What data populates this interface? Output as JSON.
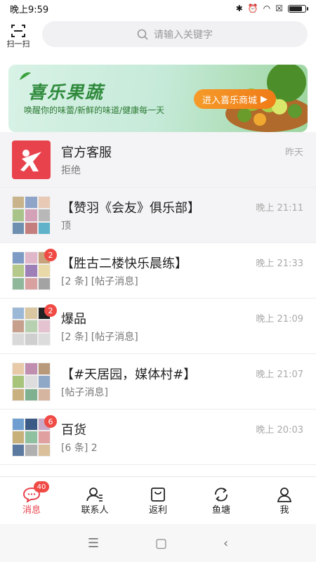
{
  "status": {
    "time": "晚上9:59"
  },
  "topbar": {
    "scan_label": "扫一扫",
    "search_placeholder": "请输入关键字"
  },
  "banner": {
    "title": "喜乐果蔬",
    "subtitle": "唤醒你的味蕾/新鲜的味道/健康每一天",
    "cta": "进入喜乐商城"
  },
  "list": [
    {
      "title": "官方客服",
      "subtitle": "拒绝",
      "time": "昨天",
      "badge": ""
    },
    {
      "title": "【赞羽《会友》俱乐部】",
      "subtitle": "顶",
      "time": "晚上 21:11",
      "badge": ""
    },
    {
      "title": "【胜古二楼快乐晨练】",
      "subtitle": "[2 条] [帖子消息]",
      "time": "晚上 21:33",
      "badge": "2"
    },
    {
      "title": "爆品",
      "subtitle": "[2 条] [帖子消息]",
      "time": "晚上 21:09",
      "badge": "2"
    },
    {
      "title": "【#天居园，媒体村#】",
      "subtitle": "[帖子消息]",
      "time": "晚上 21:07",
      "badge": ""
    },
    {
      "title": "百货",
      "subtitle": "[6 条] 2",
      "time": "晚上 20:03",
      "badge": "6"
    }
  ],
  "tabs": [
    {
      "label": "消息",
      "badge": "40"
    },
    {
      "label": "联系人"
    },
    {
      "label": "返利"
    },
    {
      "label": "鱼塘"
    },
    {
      "label": "我"
    }
  ],
  "colors": {
    "accent": "#e8434d",
    "brand_green": "#2f8a3c",
    "badge": "#f04a45"
  }
}
